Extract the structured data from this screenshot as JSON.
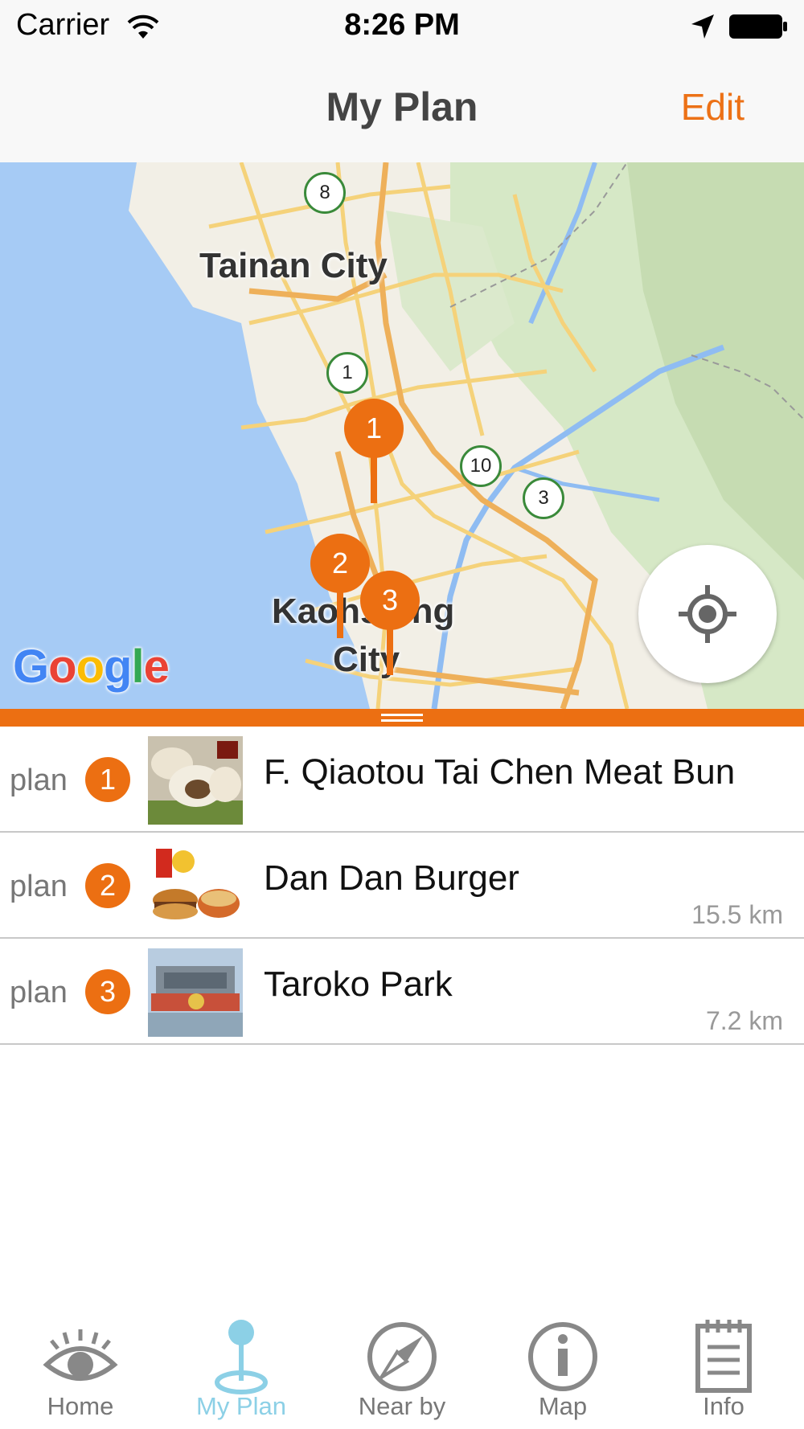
{
  "status_bar": {
    "carrier": "Carrier",
    "time": "8:26 PM"
  },
  "nav": {
    "title": "My Plan",
    "edit_label": "Edit",
    "accent": "#ec6f12"
  },
  "map": {
    "city_labels": {
      "tainan": "Tainan City",
      "kaohsiung_line1": "Kaohsiung",
      "kaohsiung_line2": "City"
    },
    "route_badges": [
      "8",
      "1",
      "10",
      "3"
    ],
    "pins": [
      "1",
      "2",
      "3"
    ],
    "attribution": [
      "G",
      "o",
      "o",
      "g",
      "l",
      "e"
    ]
  },
  "plans": [
    {
      "prefix": "plan",
      "number": "1",
      "name": "F. Qiaotou Tai Chen Meat Bun",
      "distance": ""
    },
    {
      "prefix": "plan",
      "number": "2",
      "name": "Dan Dan Burger",
      "distance": "15.5 km"
    },
    {
      "prefix": "plan",
      "number": "3",
      "name": "Taroko Park",
      "distance": "7.2 km"
    }
  ],
  "tabs": [
    {
      "label": "Home",
      "icon": "eye-icon",
      "active": false
    },
    {
      "label": "My Plan",
      "icon": "map-pin-icon",
      "active": true
    },
    {
      "label": "Near by",
      "icon": "compass-icon",
      "active": false
    },
    {
      "label": "Map",
      "icon": "info-circle-icon",
      "active": false
    },
    {
      "label": "Info",
      "icon": "notepad-icon",
      "active": false
    }
  ],
  "colors": {
    "active_tab": "#8cd0e6",
    "inactive_tab": "#888888",
    "sea": "#a6cbf5"
  }
}
